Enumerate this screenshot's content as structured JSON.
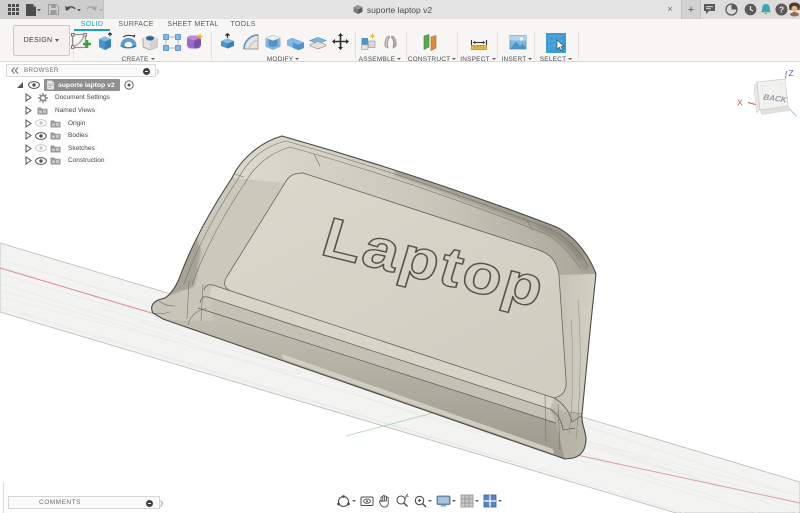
{
  "titlebar": {
    "document_title": "suporte laptop v2",
    "close_glyph": "×",
    "new_tab_glyph": "+",
    "help_glyph": "?"
  },
  "toolbar": {
    "design_label": "DESIGN",
    "tabs": [
      {
        "label": "SOLID"
      },
      {
        "label": "SURFACE"
      },
      {
        "label": "SHEET METAL"
      },
      {
        "label": "TOOLS"
      }
    ],
    "active_tab": "SOLID",
    "groups": [
      {
        "label": "CREATE"
      },
      {
        "label": "MODIFY"
      },
      {
        "label": "ASSEMBLE"
      },
      {
        "label": "CONSTRUCT"
      },
      {
        "label": "INSPECT"
      },
      {
        "label": "INSERT"
      },
      {
        "label": "SELECT"
      }
    ]
  },
  "browser": {
    "title": "BROWSER",
    "root_label": "suporte laptop v2",
    "items": [
      {
        "label": "Document Settings",
        "icon": "gear",
        "eye": "none"
      },
      {
        "label": "Named Views",
        "icon": "folder",
        "eye": "none"
      },
      {
        "label": "Origin",
        "icon": "folder",
        "eye": "hidden"
      },
      {
        "label": "Bodies",
        "icon": "folder",
        "eye": "visible"
      },
      {
        "label": "Sketches",
        "icon": "folder",
        "eye": "hidden"
      },
      {
        "label": "Construction",
        "icon": "folder",
        "eye": "visible"
      }
    ]
  },
  "comments": {
    "title": "COMMENTS"
  },
  "viewcube": {
    "face_label": "BACK",
    "axis_x_label": "X",
    "axis_z_label": "Z"
  },
  "model": {
    "engraving": "Laptop"
  },
  "colors": {
    "accent": "#16a5b2",
    "selection": "#8f8f8f",
    "axis-x": "#d98c8c",
    "axis-y": "#96c896",
    "axis-z": "#6b6bd6",
    "model-face": "#d2cfc3",
    "engrave": "#54534b",
    "select-blue": "#3b9bd4"
  }
}
